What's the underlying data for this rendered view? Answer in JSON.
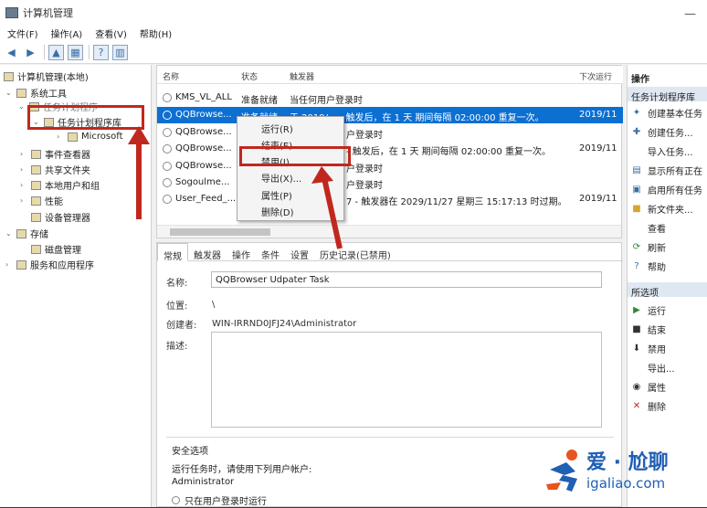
{
  "window": {
    "title": "计算机管理"
  },
  "menu": [
    "文件(F)",
    "操作(A)",
    "查看(V)",
    "帮助(H)"
  ],
  "tree": {
    "root": "计算机管理(本地)",
    "system_tools": "系统工具",
    "task_scheduler_parent": "任务计划程序",
    "task_scheduler_lib": "任务计划程序库",
    "microsoft": "Microsoft",
    "event_viewer": "事件查看器",
    "shared_folders": "共享文件夹",
    "local_users": "本地用户和组",
    "performance": "性能",
    "device_manager": "设备管理器",
    "storage": "存储",
    "disk_mgmt": "磁盘管理",
    "services": "服务和应用程序"
  },
  "list": {
    "headers": {
      "name": "名称",
      "status": "状态",
      "trigger": "触发器",
      "next": "下次运行"
    },
    "rows": [
      {
        "name": "KMS_VL_ALL",
        "status": "准备就绪",
        "trigger": "当任何用户登录时",
        "next": ""
      },
      {
        "name": "QQBrowse...",
        "status": "准备就绪",
        "trigger": "于 2019/... - 触发后，在 1 天 期间每隔 02:00:00 重复一次。",
        "next": "2019/11"
      },
      {
        "name": "QQBrowse...",
        "status": "",
        "trigger": "户登录时",
        "next": ""
      },
      {
        "name": "QQBrowse...",
        "status": "",
        "trigger": "- 触发后，在 1 天 期间每隔 02:00:00 重复一次。",
        "next": "2019/11"
      },
      {
        "name": "QQBrowse...",
        "status": "",
        "trigger": "户登录时",
        "next": ""
      },
      {
        "name": "Sogoulme...",
        "status": "",
        "trigger": "户登录时",
        "next": ""
      },
      {
        "name": "User_Feed_...",
        "status": "",
        "trigger": "7 - 触发器在 2029/11/27 星期三 15:17:13 时过期。",
        "next": "2019/11"
      }
    ]
  },
  "context_menu": [
    "运行(R)",
    "结束(E)",
    "禁用(I)",
    "导出(X)...",
    "属性(P)",
    "删除(D)"
  ],
  "tabs": [
    "常规",
    "触发器",
    "操作",
    "条件",
    "设置",
    "历史记录(已禁用)"
  ],
  "general": {
    "name_label": "名称:",
    "name_value": "QQBrowser Udpater Task",
    "location_label": "位置:",
    "location_value": "\\",
    "author_label": "创建者:",
    "author_value": "WIN-IRRND0JFJ24\\Administrator",
    "desc_label": "描述:",
    "security_label": "安全选项",
    "run_as_text": "运行任务时，请使用下列用户帐户:",
    "account": "Administrator",
    "radio_text": "只在用户登录时运行"
  },
  "actions": {
    "header": "操作",
    "section1": "任务计划程序库",
    "items1": [
      "创建基本任务",
      "创建任务...",
      "导入任务...",
      "显示所有正在",
      "启用所有任务",
      "新文件夹...",
      "查看",
      "刷新",
      "帮助"
    ],
    "section2": "所选项",
    "items2": [
      "运行",
      "结束",
      "禁用",
      "导出...",
      "属性",
      "删除"
    ]
  },
  "watermark": {
    "line1": "爱 · 尬聊",
    "line2": "igaliao.com"
  },
  "colors": {
    "selection": "#0c6fd2",
    "annotation": "#c0281e",
    "watermark": "#1f5fb4"
  }
}
